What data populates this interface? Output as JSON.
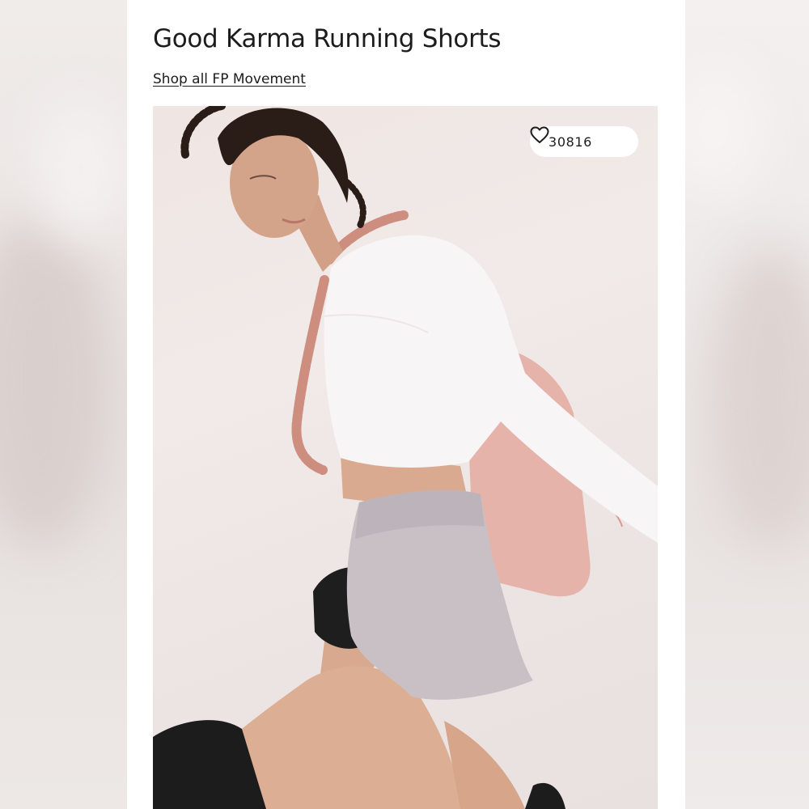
{
  "product": {
    "title": "Good Karma Running Shorts",
    "shop_link": "Shop all FP Movement"
  },
  "image": {
    "favorite_count": "30816",
    "favorite_icon": "heart-icon"
  },
  "colors": {
    "background": "#ffffff",
    "text": "#1c1c1c",
    "pill": "#ffffff"
  }
}
